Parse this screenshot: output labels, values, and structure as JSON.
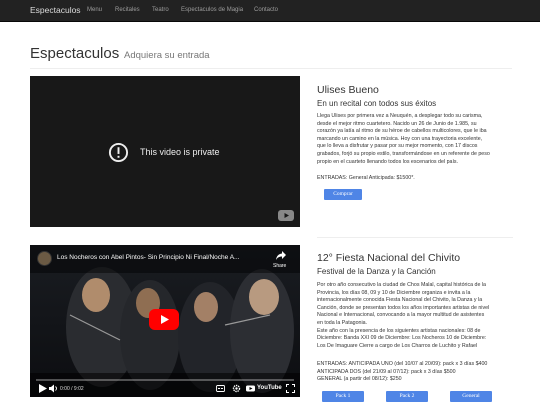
{
  "navbar": {
    "brand": "Espectaculos",
    "items": [
      "Menu",
      "Recitales",
      "Teatro",
      "Espectaculos de Magia",
      "Contacto"
    ]
  },
  "header": {
    "title": "Espectaculos",
    "subtitle": "Adquiera su entrada"
  },
  "events": [
    {
      "video": {
        "message": "This video is private"
      },
      "title": "Ulises Bueno",
      "subtitle": "En un recital con todos sus éxitos",
      "description": [
        "Llega Ulises por primera vez a Neuquén, a desplegar todo su carisma,",
        "desde el mejor ritmo cuartetero. Nacido un 26 de Junio de 1.985, su",
        "corazón ya latía al ritmo de su héroe de cabellos multicolores, que le iba",
        "marcando un camino en la música. Hoy con una trayectoria excelente,",
        "que lo lleva a disfrutar y pasar por su mejor momento, con 17 discos",
        "grabados, forjó su propio estilo, transformándose en un referente de peso",
        "propio en el cuarteto llenando todos los escenarios del país."
      ],
      "entradas": [
        "ENTRADAS: General Anticipada: $1500*."
      ],
      "buttons": [
        "Comprar"
      ]
    },
    {
      "video": {
        "title": "Los Nocheros con Abel Pintos- Sin Principio Ni Final/Noche A...",
        "share": "Share",
        "time": "0:00 / 9:02",
        "brand": "YouTube"
      },
      "title": "12° Fiesta Nacional del Chivito",
      "subtitle": "Festival de la Danza y la Canción",
      "description": [
        "Por otro año consecutivo la ciudad de Chos Malal, capital histórica de la",
        "Provincia, los días 08, 09 y 10 de Diciembre organiza e invita a la",
        "internacionalmente conocida Fiesta Nacional del Chivito, la Danza y la",
        "Canción, donde se presentan todos los años importantes artistas de nivel",
        "Nacional e Internacional, convocando a la mayor multitud de asistentes",
        "en toda la Patagonia.",
        "Este año con la presencia de los siguientes artistas nacionales: 08 de",
        "Diciembre: Banda XXI 09 de Diciembre: Los Nocheros 10 de Diciembre:",
        "Los De Imaguare Cierre a cargo de Los Charros de Luchito y Rafael"
      ],
      "entradas": [
        "ENTRADAS: ANTICIPADA UNO (del 10/07 al 20/09): pack x 3 días $400",
        "ANTICIPADA DOS (del 21/09 al 07/12): pack x 3 días $500",
        "GENERAL (a partir del 08/12): $250"
      ],
      "buttons": [
        "Pack 1",
        "Pack 2",
        "General"
      ]
    }
  ]
}
